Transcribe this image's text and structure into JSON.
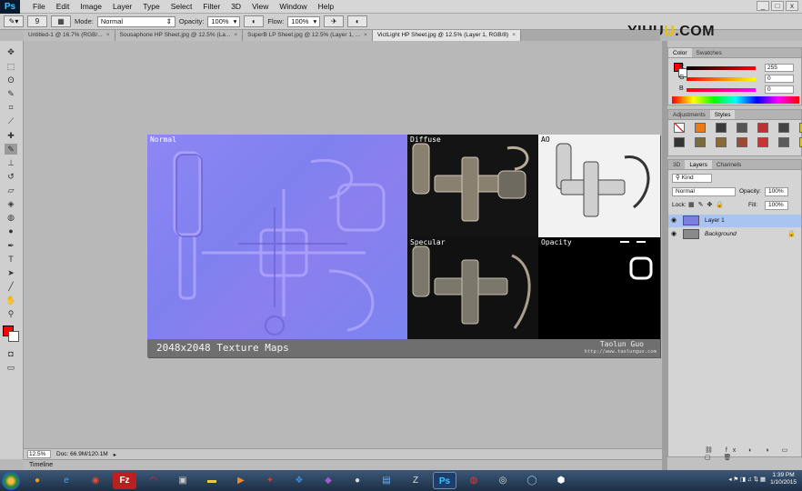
{
  "app": {
    "logo": "Ps"
  },
  "menu": [
    "File",
    "Edit",
    "Image",
    "Layer",
    "Type",
    "Select",
    "Filter",
    "3D",
    "View",
    "Window",
    "Help"
  ],
  "window_controls": [
    "_",
    "□",
    "x"
  ],
  "watermark": {
    "text_a": "YIHU",
    "text_b": "U",
    "text_c": ".COM"
  },
  "options": {
    "brush_size": "9",
    "mode_label": "Mode:",
    "mode_value": "Normal",
    "opacity_label": "Opacity:",
    "opacity_value": "100%",
    "flow_label": "Flow:",
    "flow_value": "100%"
  },
  "tabs": [
    {
      "label": "Untitled-1 @ 16.7% (RGB/...",
      "active": false
    },
    {
      "label": "Sousaphone HP Sheet.jpg @ 12.5% (La...",
      "active": false
    },
    {
      "label": "SuperB LP Sheet.jpg @ 12.5% (Layer 1, ...",
      "active": false
    },
    {
      "label": "VictLight HP Sheet.jpg @ 12.5% (Layer 1, RGB/8)",
      "active": true
    }
  ],
  "canvas": {
    "map_labels": {
      "normal": "Normal",
      "diffuse": "Diffuse",
      "ao": "AO",
      "specular": "Specular",
      "opacity": "Opacity"
    },
    "caption": "2048x2048 Texture Maps",
    "author": "Taolun Guo",
    "author_url": "http://www.taolunguo.com"
  },
  "status": {
    "zoom": "12.5%",
    "doc": "Doc: 66.9M/120.1M"
  },
  "timeline_label": "Timeline",
  "color_panel": {
    "tabs": [
      "Color",
      "Swatches"
    ],
    "r_label": "R",
    "g_label": "G",
    "b_label": "B",
    "r_value": "255",
    "g_value": "0",
    "b_value": "0"
  },
  "styles_panel": {
    "tabs": [
      "Adjustments",
      "Styles"
    ]
  },
  "layers_panel": {
    "tabs": [
      "3D",
      "Layers",
      "Channels"
    ],
    "kind_label": "Kind",
    "blend_mode": "Normal",
    "opacity_label": "Opacity:",
    "opacity_value": "100%",
    "lock_label": "Lock:",
    "fill_label": "Fill:",
    "fill_value": "100%",
    "layers": [
      {
        "name": "Layer 1",
        "selected": true
      },
      {
        "name": "Background",
        "selected": false
      }
    ]
  },
  "clock": {
    "time": "1:39 PM",
    "date": "1/10/2015"
  },
  "colors": {
    "foreground": "#ff0000",
    "background": "#ffffff",
    "selected_layer": "#a9c4f0"
  }
}
